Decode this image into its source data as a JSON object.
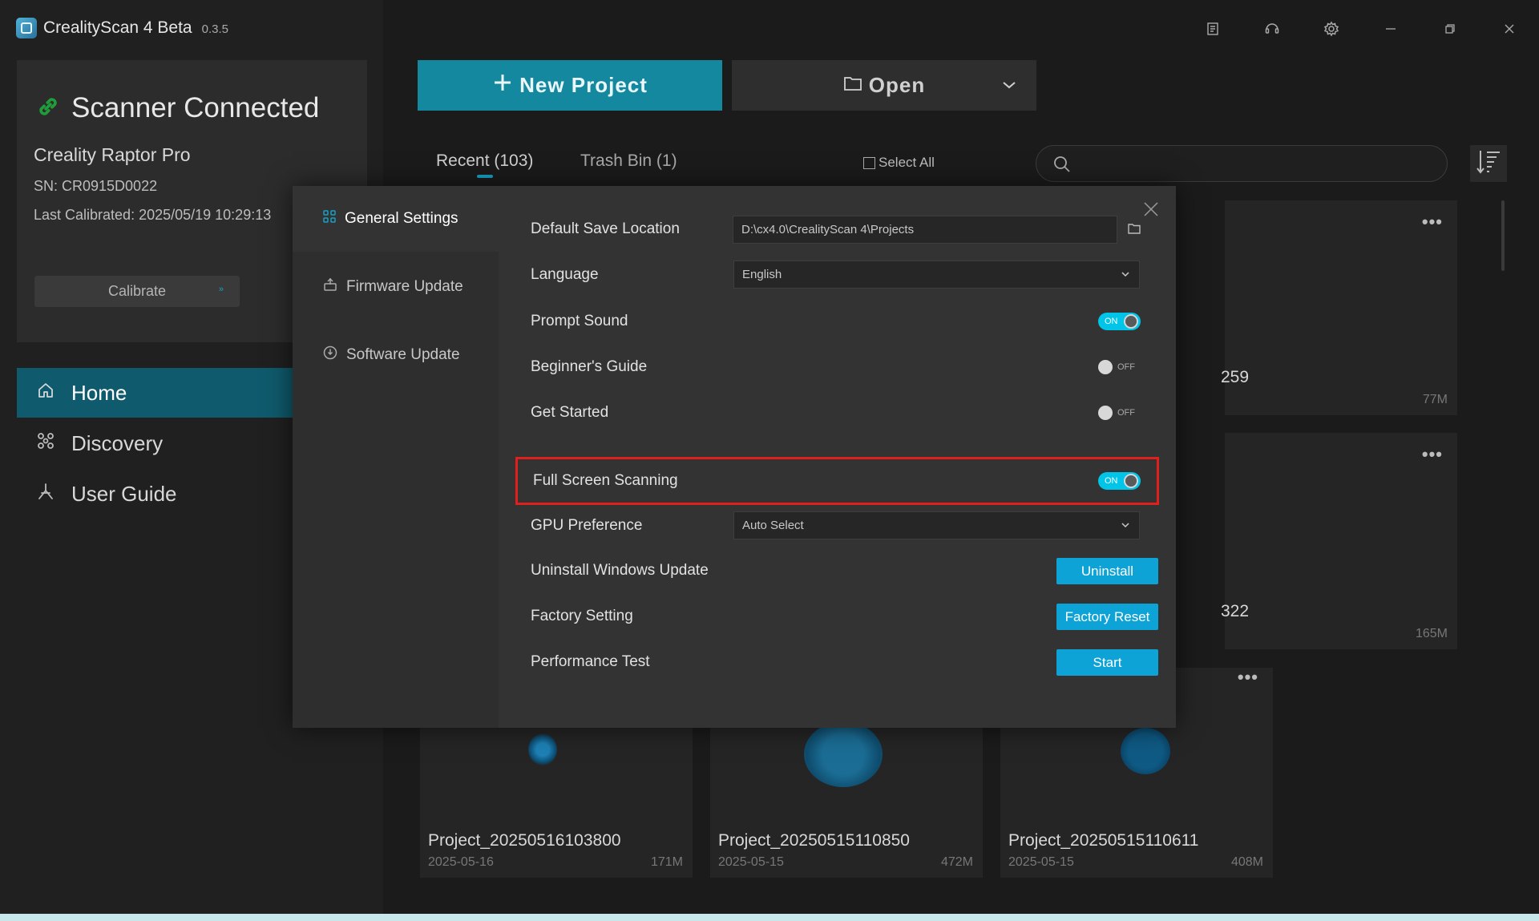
{
  "app": {
    "name": "CrealityScan 4 Beta",
    "version": "0.3.5"
  },
  "scanner": {
    "status": "Scanner Connected",
    "model": "Creality Raptor Pro",
    "sn": "SN: CR0915D0022",
    "last_calibrated": "Last Calibrated: 2025/05/19 10:29:13",
    "calibrate_label": "Calibrate"
  },
  "nav": [
    {
      "label": "Home",
      "icon": "home-icon"
    },
    {
      "label": "Discovery",
      "icon": "discovery-icon"
    },
    {
      "label": "User Guide",
      "icon": "user-guide-icon"
    }
  ],
  "toolbar": {
    "new_project": "New Project",
    "open": "Open"
  },
  "tabs": {
    "recent": "Recent (103)",
    "trash": "Trash Bin (1)",
    "select_all": "Select All"
  },
  "search": {
    "placeholder": ""
  },
  "projects": [
    {
      "name": "Project_20250516103800",
      "date": "2025-05-16",
      "size": "171M"
    },
    {
      "name": "Project_20250515110850",
      "date": "2025-05-15",
      "size": "472M"
    },
    {
      "name": "Project_20250515110611",
      "date": "2025-05-15",
      "size": "408M"
    }
  ],
  "partial_cards": [
    {
      "name_fragment": "259",
      "size": "77M"
    },
    {
      "name_fragment": "322",
      "size": "165M"
    }
  ],
  "dialog": {
    "sidebar": [
      {
        "label": "General Settings",
        "icon": "grid-icon"
      },
      {
        "label": "Firmware Update",
        "icon": "firmware-icon"
      },
      {
        "label": "Software Update",
        "icon": "software-update-icon"
      }
    ],
    "rows": {
      "save_location": {
        "label": "Default Save Location",
        "value": "D:\\cx4.0\\CrealityScan 4\\Projects"
      },
      "language": {
        "label": "Language",
        "value": "English"
      },
      "prompt_sound": {
        "label": "Prompt Sound",
        "state": "ON"
      },
      "beginners_guide": {
        "label": "Beginner's Guide",
        "state": "OFF"
      },
      "get_started": {
        "label": "Get Started",
        "state": "OFF"
      },
      "full_screen": {
        "label": "Full Screen Scanning",
        "state": "ON"
      },
      "gpu": {
        "label": "GPU Preference",
        "value": "Auto Select"
      },
      "uninstall": {
        "label": "Uninstall Windows Update",
        "button": "Uninstall"
      },
      "factory": {
        "label": "Factory Setting",
        "button": "Factory Reset"
      },
      "perf": {
        "label": "Performance Test",
        "button": "Start"
      }
    }
  },
  "colors": {
    "accent": "#13889f",
    "toggle_on": "#00c4e8",
    "button_blue": "#0ea3d6",
    "highlight": "#e0201c"
  }
}
